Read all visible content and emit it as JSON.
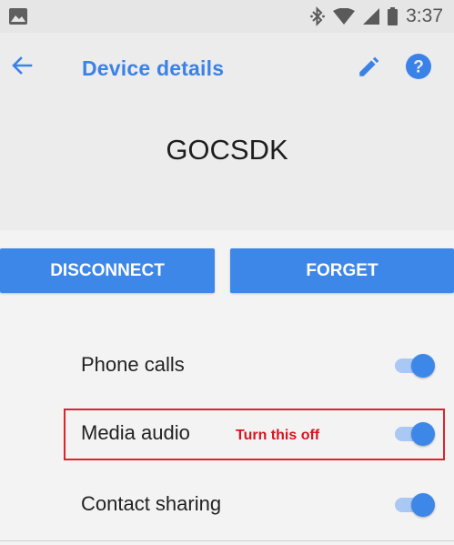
{
  "status_bar": {
    "time": "3:37",
    "icons": [
      "image-notification-icon",
      "bluetooth-icon",
      "wifi-icon",
      "cellular-signal-icon",
      "battery-icon"
    ]
  },
  "header": {
    "title": "Device details",
    "device_name": "GOCSDK",
    "icons": [
      "back-arrow-icon",
      "edit-pencil-icon",
      "help-icon"
    ]
  },
  "actions": {
    "disconnect_label": "DISCONNECT",
    "forget_label": "FORGET"
  },
  "settings": [
    {
      "label": "Phone calls",
      "enabled": true
    },
    {
      "label": "Media audio",
      "enabled": true
    },
    {
      "label": "Contact sharing",
      "enabled": true
    }
  ],
  "annotation": {
    "text": "Turn this off",
    "color": "#e0212e"
  },
  "colors": {
    "accent": "#3d87e8",
    "toggle_track": "#a9c8f4",
    "background": "#f3f3f3",
    "header_background": "#ececec"
  }
}
